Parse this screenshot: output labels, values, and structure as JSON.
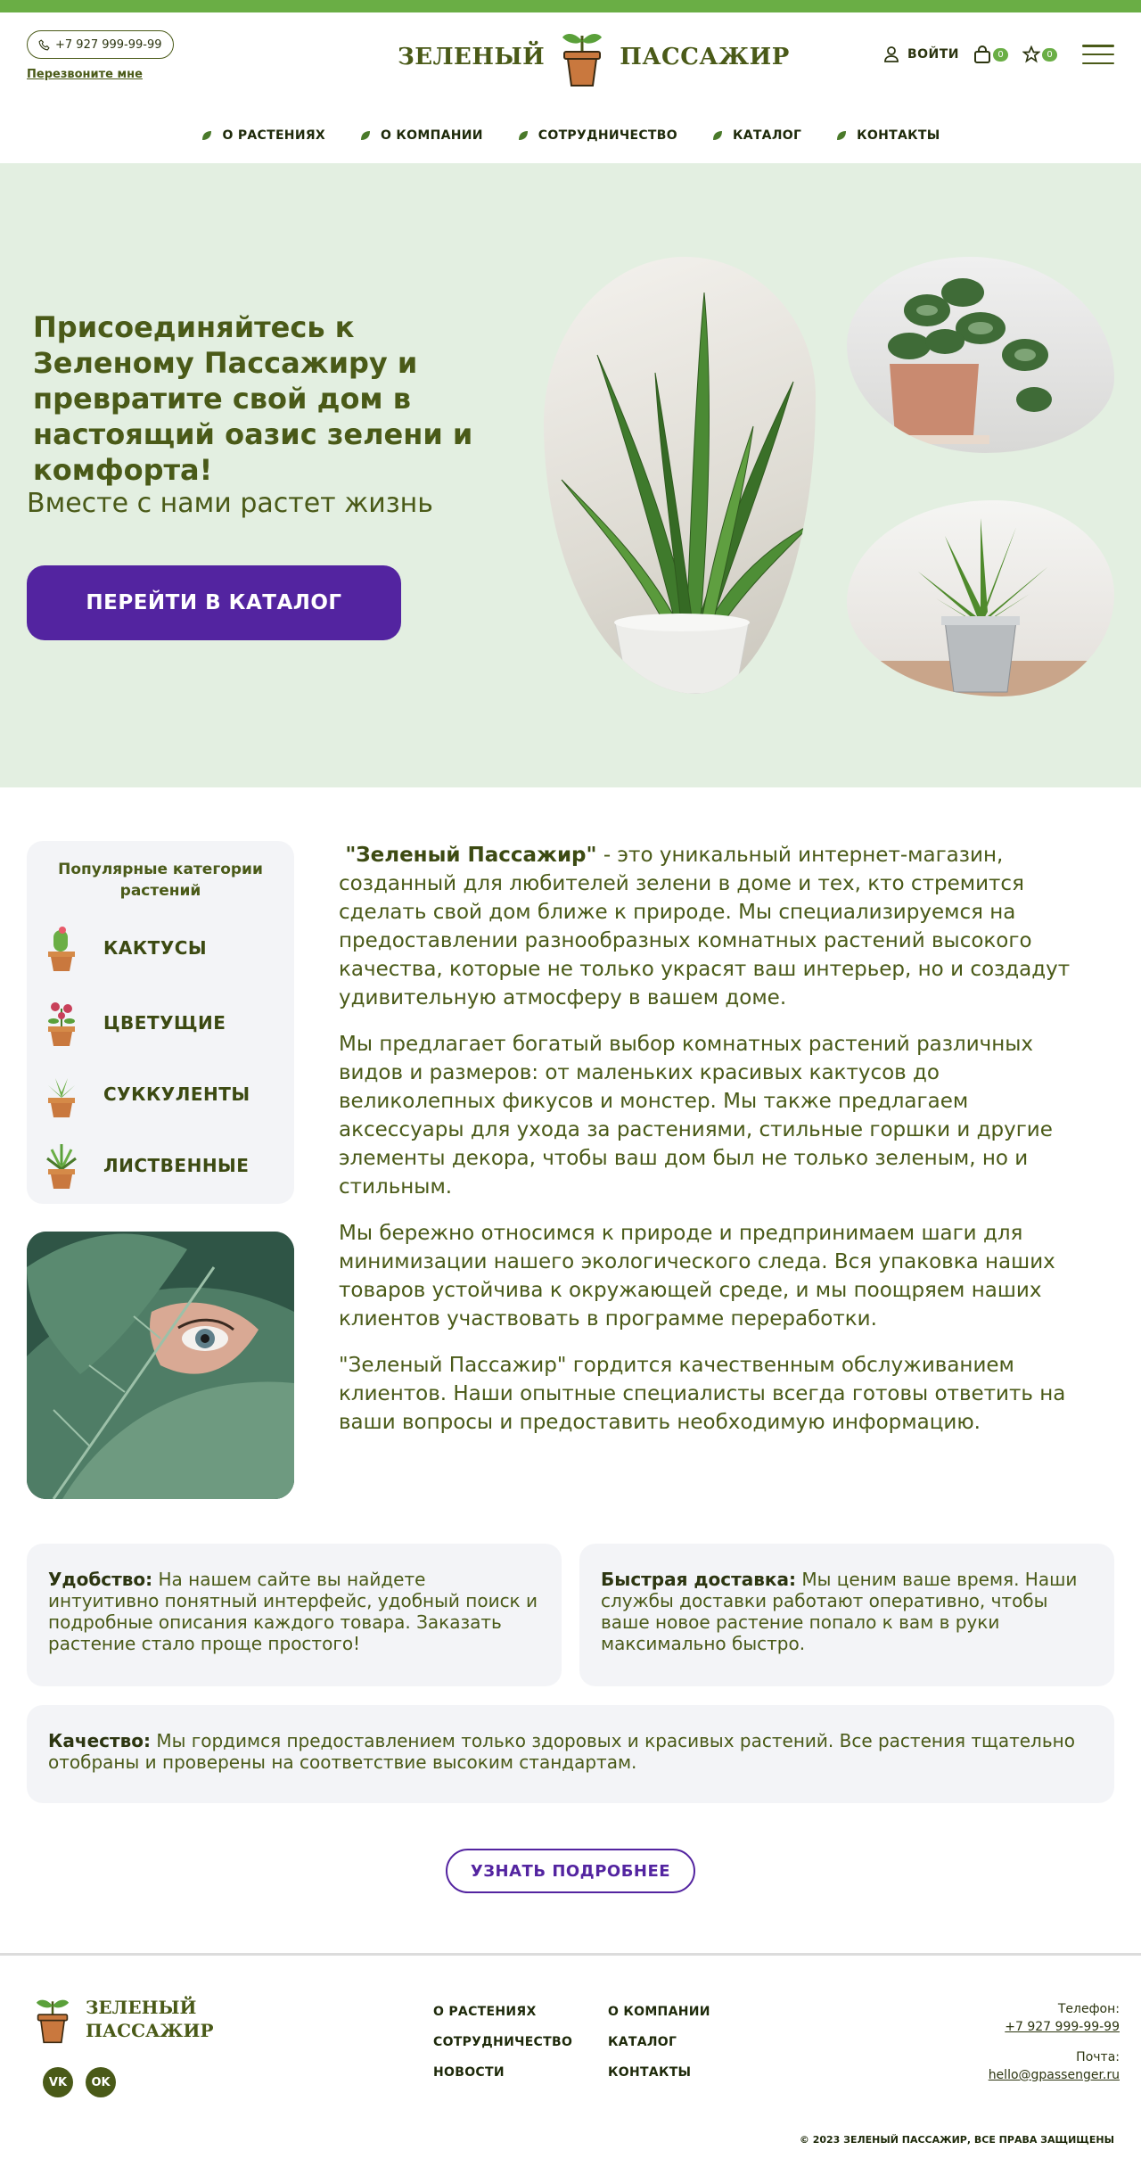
{
  "header": {
    "phone": "+7 927 999-99-99",
    "callback": "Перезвоните мне",
    "logo_left": "ЗЕЛЕНЫЙ",
    "logo_right": "ПАССАЖИР",
    "login": "ВОЙТИ",
    "cart_count": "0",
    "fav_count": "0"
  },
  "nav": [
    {
      "label": "О РАСТЕНИЯХ"
    },
    {
      "label": "О КОМПАНИИ"
    },
    {
      "label": "СОТРУДНИЧЕСТВО"
    },
    {
      "label": "КАТАЛОГ"
    },
    {
      "label": "КОНТАКТЫ"
    }
  ],
  "hero": {
    "title": "Присоединяйтесь к Зеленому Пассажиру и превратите свой дом в настоящий оазис зелени и комфорта!",
    "subtitle": "Вместе с нами растет жизнь",
    "button": "ПЕРЕЙТИ В КАТАЛОГ"
  },
  "categories": {
    "title": "Популярные категории растений",
    "items": [
      {
        "label": "КАКТУСЫ",
        "icon": "cactus-pot-icon"
      },
      {
        "label": "ЦВЕТУЩИЕ",
        "icon": "flower-pot-icon"
      },
      {
        "label": "СУККУЛЕНТЫ",
        "icon": "succulent-pot-icon"
      },
      {
        "label": "ЛИСТВЕННЫЕ",
        "icon": "leafy-pot-icon"
      }
    ]
  },
  "about": {
    "p1_bold": "\"Зеленый Пассажир\"",
    "p1_rest": " - это уникальный интернет-магазин, созданный для любителей зелени в доме и тех, кто стремится сделать свой дом ближе к природе. Мы специализируемся на предоставлении разнообразных комнатных растений высокого качества, которые не только украсят ваш интерьер, но и создадут удивительную атмосферу в вашем доме.",
    "p2": "Мы предлагает богатый выбор комнатных растений различных видов и размеров: от маленьких красивых кактусов до великолепных фикусов и монстер. Мы также предлагаем аксессуары для ухода за растениями, стильные горшки и другие элементы декора, чтобы ваш дом был не только зеленым, но и стильным.",
    "p3": "Мы бережно относимся к природе и предпринимаем шаги для минимизации нашего экологического следа. Вся упаковка наших товаров устойчива к окружающей среде, и мы поощряем наших клиентов участвовать в программе переработки.",
    "p4": "\"Зеленый Пассажир\" гордится качественным обслуживанием клиентов. Наши опытные специалисты всегда готовы ответить на ваши вопросы и предоставить необходимую информацию."
  },
  "features": [
    {
      "title": "Удобство:",
      "text": " На нашем сайте вы найдете интуитивно понятный интерфейс, удобный поиск и подробные описания каждого товара. Заказать растение стало проще простого!"
    },
    {
      "title": "Быстрая доставка:",
      "text": " Мы ценим ваше время. Наши службы доставки работают оперативно, чтобы ваше новое растение попало к вам в руки максимально быстро."
    },
    {
      "title": "Качество:",
      "text": " Мы гордимся предоставлением только здоровых и красивых растений. Все растения тщательно отобраны и проверены на соответствие высоким стандартам."
    }
  ],
  "more_button": "УЗНАТЬ ПОДРОБНЕЕ",
  "footer": {
    "logo_line1": "ЗЕЛЕНЫЙ",
    "logo_line2": "ПАССАЖИР",
    "socials": [
      "VK",
      "OK"
    ],
    "links": [
      "О РАСТЕНИЯХ",
      "О КОМПАНИИ",
      "СОТРУДНИЧЕСТВО",
      "КАТАЛОГ",
      "НОВОСТИ",
      "КОНТАКТЫ"
    ],
    "phone_label": "Телефон:",
    "phone": "+7 927 999-99-99",
    "email_label": "Почта:",
    "email": "hello@gpassenger.ru",
    "copyright": "© 2023 ЗЕЛЕНЫЙ ПАССАЖИР, ВСЕ ПРАВА ЗАЩИЩЕНЫ"
  },
  "colors": {
    "accent_green": "#6aae45",
    "text_olive": "#4a5a18",
    "button_purple": "#5324a0",
    "hero_bg": "#e3efe1"
  }
}
